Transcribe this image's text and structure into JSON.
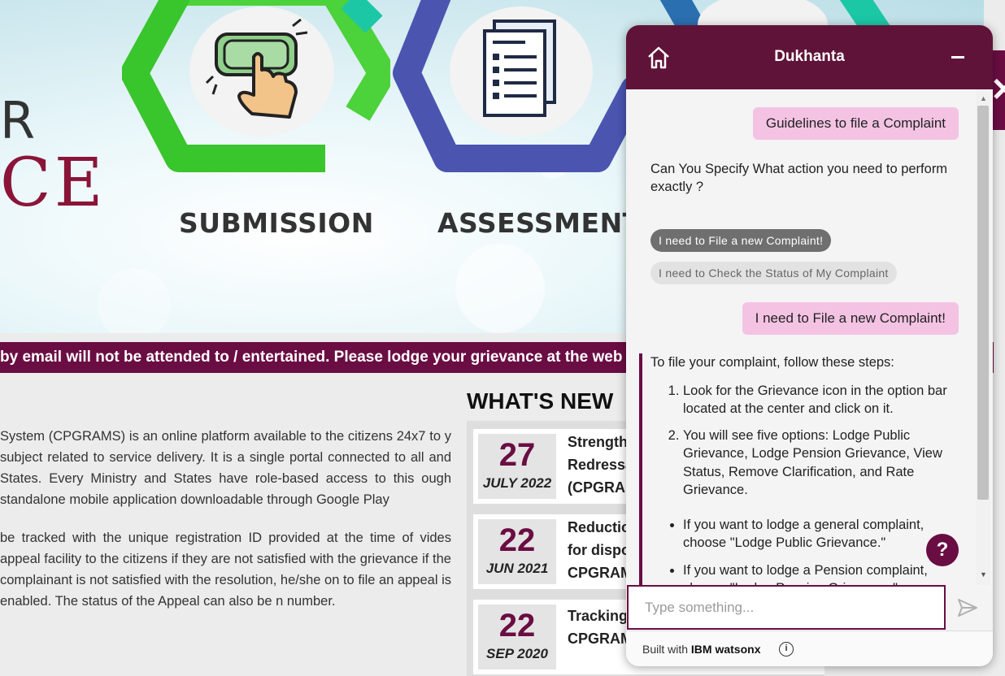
{
  "hero": {
    "letters_top": "R",
    "letters_bottom": "CE",
    "stage_labels": [
      "SUBMISSION",
      "ASSESSMENT"
    ]
  },
  "marquee": {
    "text": "by email will not be attended to / entertained. Please lodge your grievance at the web"
  },
  "about": {
    "paragraph_1": "System (CPGRAMS) is an online platform available to the citizens 24x7 to y subject related to service delivery. It is a single portal connected to all and States. Every Ministry and States have role-based access to this ough standalone mobile application downloadable through Google Play",
    "paragraph_2": "be tracked with the unique registration ID provided at the time of vides appeal facility to the citizens if they are not satisfied with the grievance if the complainant is not satisfied with the resolution, he/she on to file an appeal is enabled. The status of the Appeal can also be n number."
  },
  "whats_new": {
    "title": "WHAT'S NEW",
    "items": [
      {
        "day": "27",
        "month": "JULY 2022",
        "text": "Strength\nRedressa\n(CPGRAM"
      },
      {
        "day": "22",
        "month": "JUN 2021",
        "text": "Reduction\nfor dispo\nCPGRAM"
      },
      {
        "day": "22",
        "month": "SEP 2020",
        "text": "Tracking\nCPGRAM"
      }
    ]
  },
  "chat": {
    "title": "Dukhanta",
    "messages": {
      "user_1": "Guidelines to file a Complaint",
      "bot_1": "Can You Specify What action you need to perform exactly ?",
      "chip_1": "I need to File a new Complaint!",
      "chip_2": "I need to Check the Status of My Complaint",
      "user_2": "I need to File a new Complaint!",
      "bot_2_intro": "To file your complaint, follow these steps:",
      "steps": [
        "Look for the Grievance icon in the option bar located at the center and click on it.",
        "You will see five options: Lodge Public Grievance, Lodge Pension Grievance, View Status, Remove Clarification, and Rate Grievance."
      ],
      "bullets": [
        "If you want to lodge a general complaint, choose \"Lodge Public Grievance.\"",
        "If you want to lodge a Pension complaint, choose \"Lodge Pension Grievance.\""
      ]
    },
    "input_placeholder": "Type something...",
    "footer_prefix": "Built with",
    "footer_brand": "IBM watsonx",
    "help_symbol": "?"
  },
  "colors": {
    "brand_maroon": "#6a0d43",
    "chat_header": "#601338",
    "user_bubble": "#f4c3e4",
    "hex_green": "#4cd23a",
    "hex_blue": "#4b55b0",
    "hex_teal": "#1cc7a6"
  },
  "icons": [
    "click-button-icon",
    "document-list-icon",
    "home-icon",
    "minimize-icon",
    "send-icon",
    "info-icon",
    "help-icon",
    "close-x-icon"
  ]
}
